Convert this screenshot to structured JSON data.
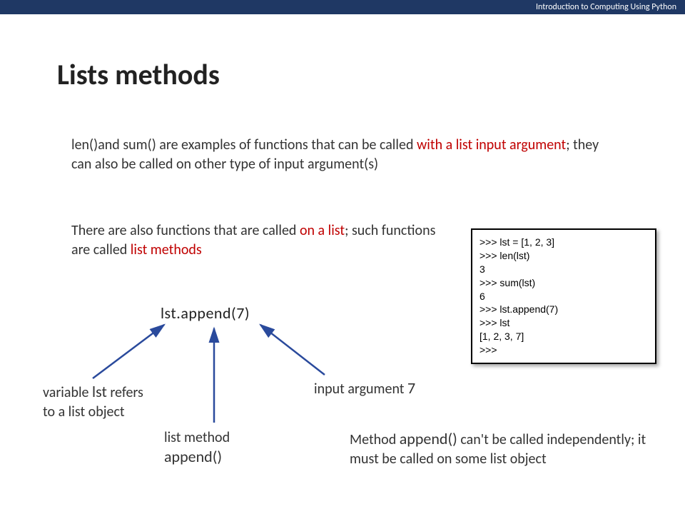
{
  "header": {
    "course": "Introduction to Computing Using Python"
  },
  "title": "Lists methods",
  "para1": {
    "len": "len()",
    "and": "and",
    "sum": "sum()",
    "rest1": " are examples of functions that can be called ",
    "highlight1": "with a list input argument",
    "rest2": "; they can also be called on other type of input argument(s)"
  },
  "para2": {
    "t1": "There are also functions that are called ",
    "h1": "on a list",
    "t2": "; such functions are called ",
    "h2": "list methods"
  },
  "center_expr": "lst.append(7)",
  "labels": {
    "var_a": "variable ",
    "var_b": "lst",
    "var_c": " refers to a list object",
    "method_a": "list method",
    "method_b": "append()",
    "arg_a": "input argument ",
    "arg_b": "7"
  },
  "note": {
    "t1": "Method ",
    "m": "append()",
    "t2": " can't be called independently; it must be called on some list object"
  },
  "code": ">>> lst = [1, 2, 3]\n>>> len(lst)\n3\n>>> sum(lst)\n6\n>>> lst.append(7)\n>>> lst\n[1, 2, 3, 7]\n>>>"
}
